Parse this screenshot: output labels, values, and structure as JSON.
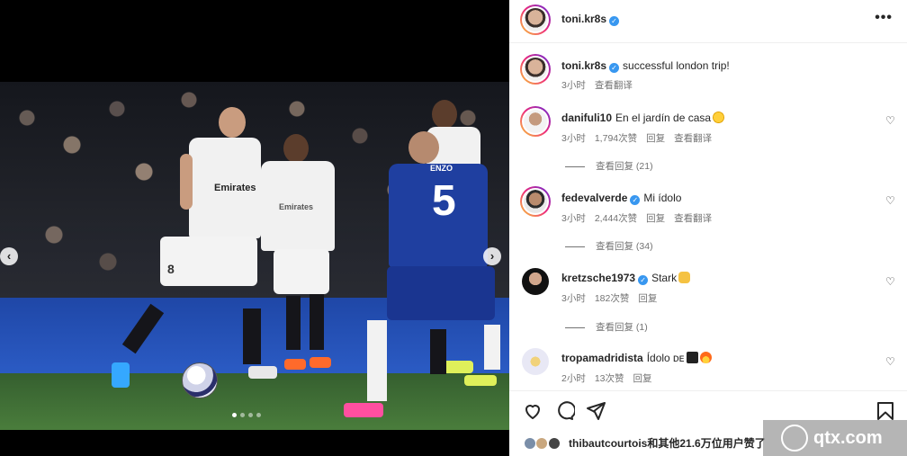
{
  "post": {
    "author": "toni.kr8s",
    "caption": "successful london trip!",
    "time": "3小时",
    "translate": "查看翻译"
  },
  "media": {
    "shirt_sponsor": "Emirates",
    "shirt_sponsor_small": "Emirates",
    "chelsea_name": "ENZO",
    "chelsea_number": "5",
    "kroos_number": "8",
    "dots": [
      true,
      false,
      false,
      false
    ],
    "prev_icon": "chevron-left-icon",
    "next_icon": "chevron-right-icon"
  },
  "comments": [
    {
      "username": "danifuli10",
      "verified": false,
      "text": "En el jardín de casa",
      "emoji": "star-struck-emoji",
      "time": "3小时",
      "likes": "1,794次赞",
      "reply": "回复",
      "translate": "查看翻译",
      "view_replies": "查看回复 (21)"
    },
    {
      "username": "fedevalverde",
      "verified": true,
      "text": "Mi ídolo",
      "time": "3小时",
      "likes": "2,444次赞",
      "reply": "回复",
      "translate": "查看翻译",
      "view_replies": "查看回复 (34)"
    },
    {
      "username": "kretzsche1973",
      "verified": true,
      "text": "Stark",
      "emoji": "clapping-hands-emoji",
      "time": "3小时",
      "likes": "182次赞",
      "reply": "回复",
      "view_replies": "查看回复 (1)"
    },
    {
      "username": "tropamadridista",
      "verified": false,
      "text": "Ídolo ᴅᴇ",
      "emoji": "top-hat-fire-emoji",
      "time": "2小时",
      "likes": "13次赞",
      "reply": "回复"
    }
  ],
  "actions": {
    "like_icon": "heart-icon",
    "comment_icon": "comment-icon",
    "share_icon": "send-icon",
    "save_icon": "bookmark-icon"
  },
  "likes_summary": {
    "user": "thibautcourtois",
    "rest": "和其他21.6万位用户赞了"
  },
  "watermark": "qtx.com",
  "colors": {
    "verified": "#3897f0",
    "story_ring_start": "#f9ce34",
    "story_ring_end": "#6228d7",
    "chelsea_blue": "#1f3fa0",
    "madrid_white": "#f1f1f1"
  }
}
